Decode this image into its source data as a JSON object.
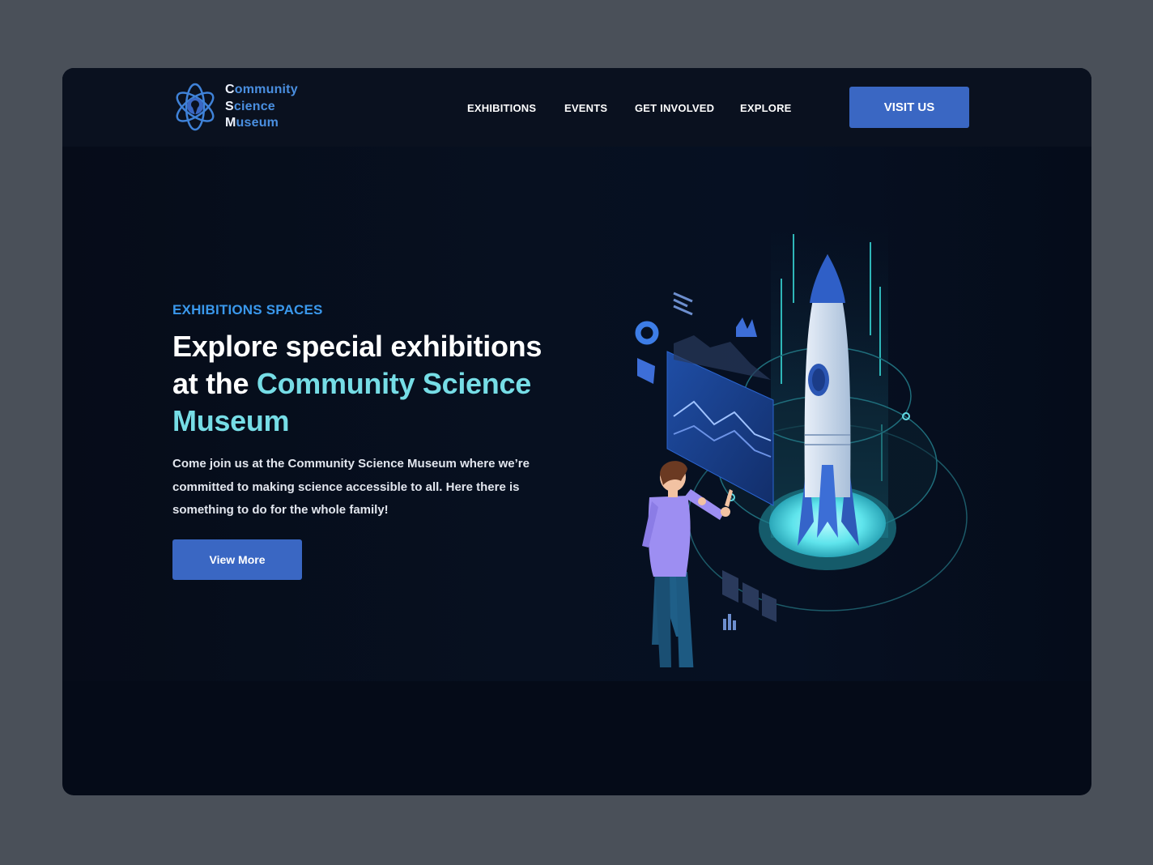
{
  "brand": {
    "name_lines": [
      "Community",
      "Science",
      "Museum"
    ],
    "logo_icon": "atom-logo-icon"
  },
  "nav": {
    "items": [
      {
        "label": "EXHIBITIONS"
      },
      {
        "label": "EVENTS"
      },
      {
        "label": "GET INVOLVED"
      },
      {
        "label": "EXPLORE"
      }
    ],
    "cta_label": "VISIT US"
  },
  "hero": {
    "eyebrow": "EXHIBITIONS SPACES",
    "title_part1": "Explore special exhibitions at the ",
    "title_accent": "Community Science Museum",
    "description": "Come join us at the Community Science Museum where we’re committed to making science accessible to all. Here there is something to do for the whole family!",
    "button_label": "View More",
    "illustration": "rocket-launch-illustration"
  },
  "colors": {
    "page_bg": "#4a5059",
    "frame_bg": "#050b18",
    "header_bg": "#0a111f",
    "primary_button": "#3a67c3",
    "eyebrow": "#3a98ec",
    "accent_text": "#76dde6"
  }
}
